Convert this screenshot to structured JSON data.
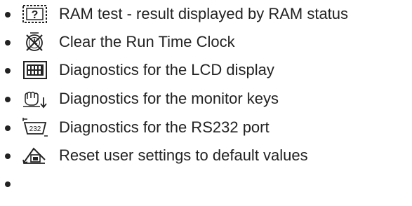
{
  "menu": {
    "items": [
      {
        "label": "RAM test - result displayed by RAM status",
        "icon": "ram-test-question-icon"
      },
      {
        "label": "Clear the Run Time Clock",
        "icon": "clock-reset-icon"
      },
      {
        "label": "Diagnostics for the LCD display",
        "icon": "lcd-display-icon"
      },
      {
        "label": "Diagnostics for the monitor keys",
        "icon": "keypad-press-icon"
      },
      {
        "label": "Diagnostics for the RS232 port",
        "icon": "rs232-port-icon"
      },
      {
        "label": "Reset user settings to default values",
        "icon": "home-reset-icon"
      },
      {
        "label": "",
        "icon": ""
      }
    ]
  }
}
